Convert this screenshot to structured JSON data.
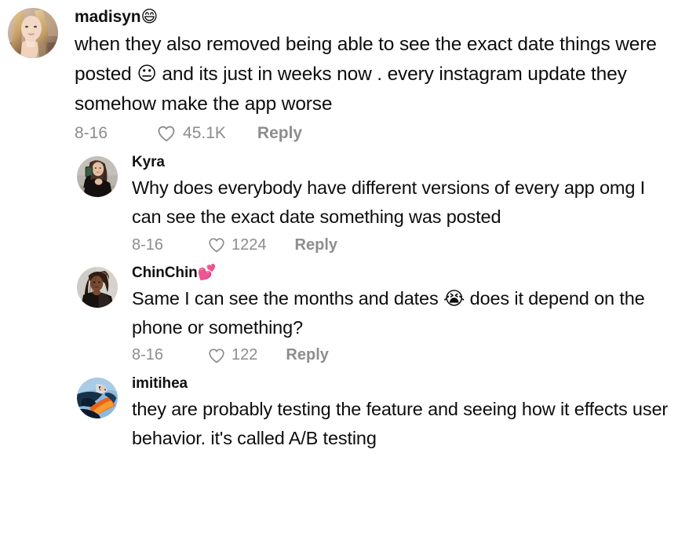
{
  "theme": {
    "background": "#ffffff",
    "text_primary": "#0d0d0d",
    "text_muted": "#8d8d8d",
    "username_color": "#111111"
  },
  "thread": {
    "comments": [
      {
        "id": "comment-madisyn",
        "level": "top-level",
        "username": "madisyn",
        "username_emoji": "😄",
        "text": "when they also removed being able to see the exact date things were posted 😐 and its just in weeks now . every instagram update they somehow make the app worse",
        "date": "8-16",
        "like_icon": "heart-icon",
        "likes": "45.1K",
        "reply_label": "Reply",
        "avatar_alt": "madisyn-avatar"
      },
      {
        "id": "comment-kyra",
        "level": "reply",
        "username": "Kyra",
        "username_emoji": "",
        "text": "Why does everybody have different versions of every app omg I can see the exact date something was posted",
        "date": "8-16",
        "like_icon": "heart-icon",
        "likes": "1224",
        "reply_label": "Reply",
        "avatar_alt": "kyra-avatar"
      },
      {
        "id": "comment-chinchin",
        "level": "reply",
        "username": "ChinChin",
        "username_emoji": "💕",
        "text": "Same I can see the months and dates 😭 does it depend on the phone or something?",
        "date": "8-16",
        "like_icon": "heart-icon",
        "likes": "122",
        "reply_label": "Reply",
        "avatar_alt": "chinchin-avatar"
      },
      {
        "id": "comment-imitihea",
        "level": "reply",
        "username": "imitihea",
        "username_emoji": "",
        "text": "they are probably testing the feature and seeing how it effects user behavior. it's called A/B testing",
        "date": "",
        "like_icon": "",
        "likes": "",
        "reply_label": "",
        "avatar_alt": "imitihea-avatar"
      }
    ]
  }
}
